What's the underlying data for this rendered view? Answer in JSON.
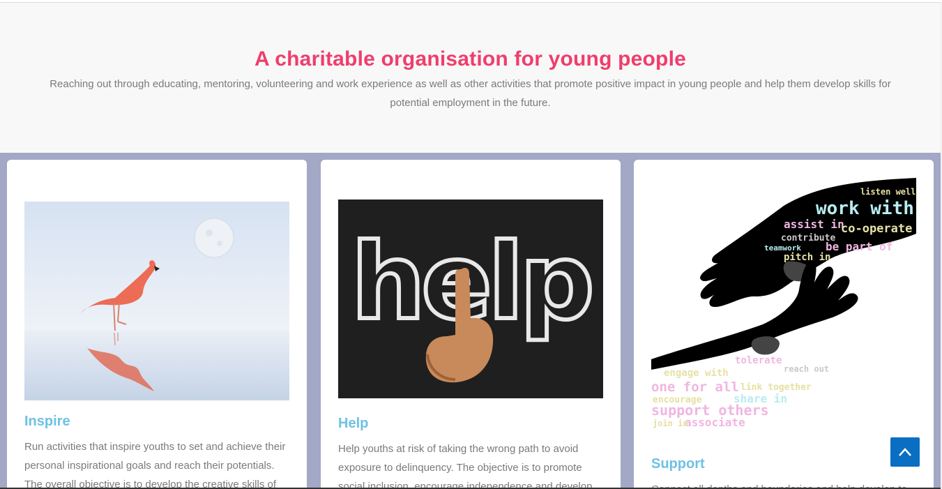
{
  "hero": {
    "title": "A charitable organisation for young people",
    "subtitle": "Reaching out through educating, mentoring, volunteering and work experience as well as other activities that promote positive impact in young people and help them develop skills for potential employment in the future."
  },
  "cards": [
    {
      "title": "Inspire",
      "image": "flamingo-image",
      "description": "Run activities that inspire youths to set and achieve their personal inspirational goals and reach their potentials. The overall objective is to develop the creative skills of"
    },
    {
      "title": "Help",
      "image": "help-chalk-image",
      "image_text": "help",
      "description": "Help youths at risk of taking the wrong path to avoid exposure to delinquency. The objective is to promote social inclusion, encourage independence and develop"
    },
    {
      "title": "Support",
      "image": "word-cloud-hands-image",
      "image_words": [
        "listen well",
        "work with",
        "assist in",
        "co-operate",
        "contribute",
        "be part of",
        "teamwork",
        "pitch in",
        "engage with",
        "tolerate",
        "reach out",
        "one for all",
        "link together",
        "share in",
        "support others",
        "associate",
        "encourage",
        "join in"
      ],
      "description": "Connect all depths and boundaries and help develop to"
    }
  ],
  "scroll_top": {
    "icon": "chevron-up-icon"
  },
  "colors": {
    "accent_pink": "#f03d6b",
    "card_title_blue": "#6ec1e4",
    "band_lavender": "#a2a8c5",
    "scroll_button_blue": "#0a6fc2"
  }
}
